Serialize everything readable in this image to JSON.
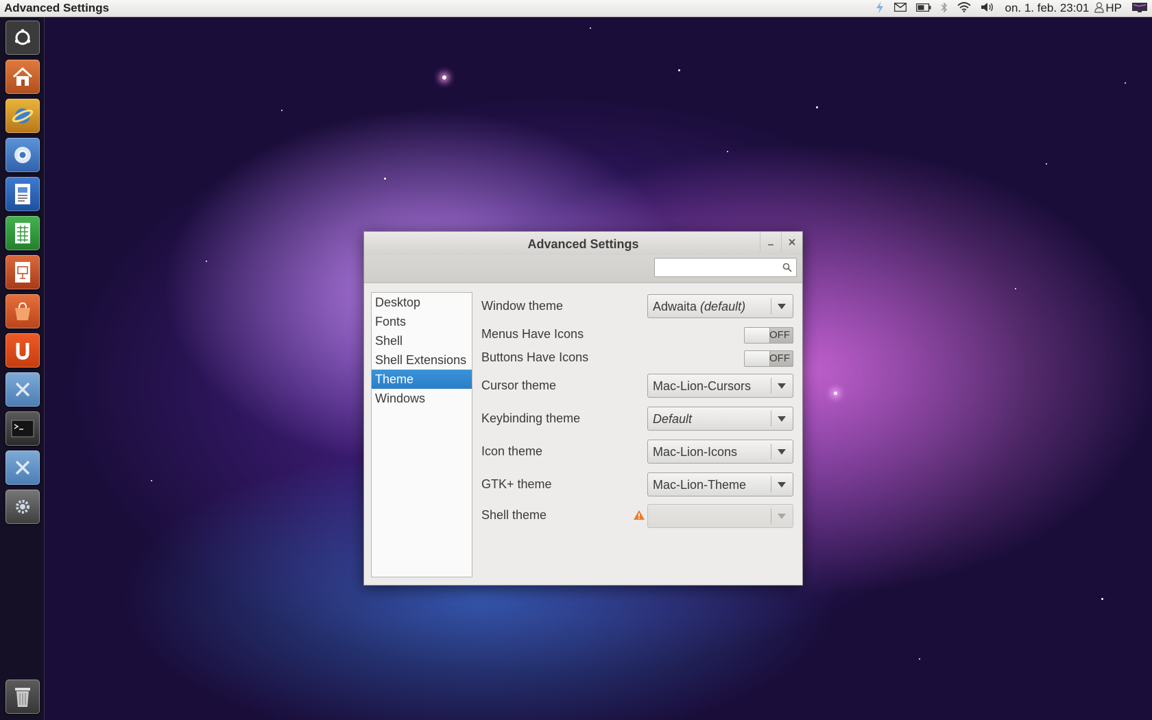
{
  "top_panel": {
    "app_title": "Advanced Settings",
    "clock": "on.  1. feb. 23:01",
    "user": "HP",
    "indicators": [
      "lightning-icon",
      "mail-icon",
      "battery-icon",
      "bluetooth-icon",
      "wifi-icon",
      "volume-icon"
    ]
  },
  "launcher": {
    "items": [
      {
        "name": "ubuntu-logo-icon",
        "color": "#3b3b3b"
      },
      {
        "name": "home-folder-icon",
        "color": "#c9622e"
      },
      {
        "name": "web-browser-icon",
        "color": "#d8a020"
      },
      {
        "name": "chromium-icon",
        "color": "#3f74c0"
      },
      {
        "name": "writer-icon",
        "color": "#2a62b8"
      },
      {
        "name": "calc-icon",
        "color": "#2f9a3a"
      },
      {
        "name": "impress-icon",
        "color": "#c4502a"
      },
      {
        "name": "software-center-icon",
        "color": "#d2552a"
      },
      {
        "name": "ubuntu-one-icon",
        "color": "#dd4a1f"
      },
      {
        "name": "tools-folder-icon",
        "color": "#5f8fc0"
      },
      {
        "name": "terminal-icon",
        "color": "#2e2e2e"
      },
      {
        "name": "tools-folder-icon",
        "color": "#5f8fc0"
      },
      {
        "name": "system-settings-icon",
        "color": "#555555"
      }
    ],
    "trash": "trash-icon"
  },
  "dialog": {
    "title": "Advanced Settings",
    "search": {
      "placeholder": "",
      "value": ""
    },
    "sidebar": [
      {
        "label": "Desktop",
        "active": false
      },
      {
        "label": "Fonts",
        "active": false
      },
      {
        "label": "Shell",
        "active": false
      },
      {
        "label": "Shell Extensions",
        "active": false
      },
      {
        "label": "Theme",
        "active": true
      },
      {
        "label": "Windows",
        "active": false
      }
    ],
    "settings": {
      "window_theme": {
        "label": "Window theme",
        "value_main": "Adwaita ",
        "value_note": "(default)"
      },
      "menus_icons": {
        "label": "Menus Have Icons",
        "state": "OFF"
      },
      "buttons_icons": {
        "label": "Buttons Have Icons",
        "state": "OFF"
      },
      "cursor_theme": {
        "label": "Cursor theme",
        "value": "Mac-Lion-Cursors"
      },
      "keybinding_theme": {
        "label": "Keybinding theme",
        "value": "Default"
      },
      "icon_theme": {
        "label": "Icon theme",
        "value": "Mac-Lion-Icons"
      },
      "gtk_theme": {
        "label": "GTK+ theme",
        "value": "Mac-Lion-Theme"
      },
      "shell_theme": {
        "label": "Shell theme",
        "value": ""
      }
    }
  }
}
